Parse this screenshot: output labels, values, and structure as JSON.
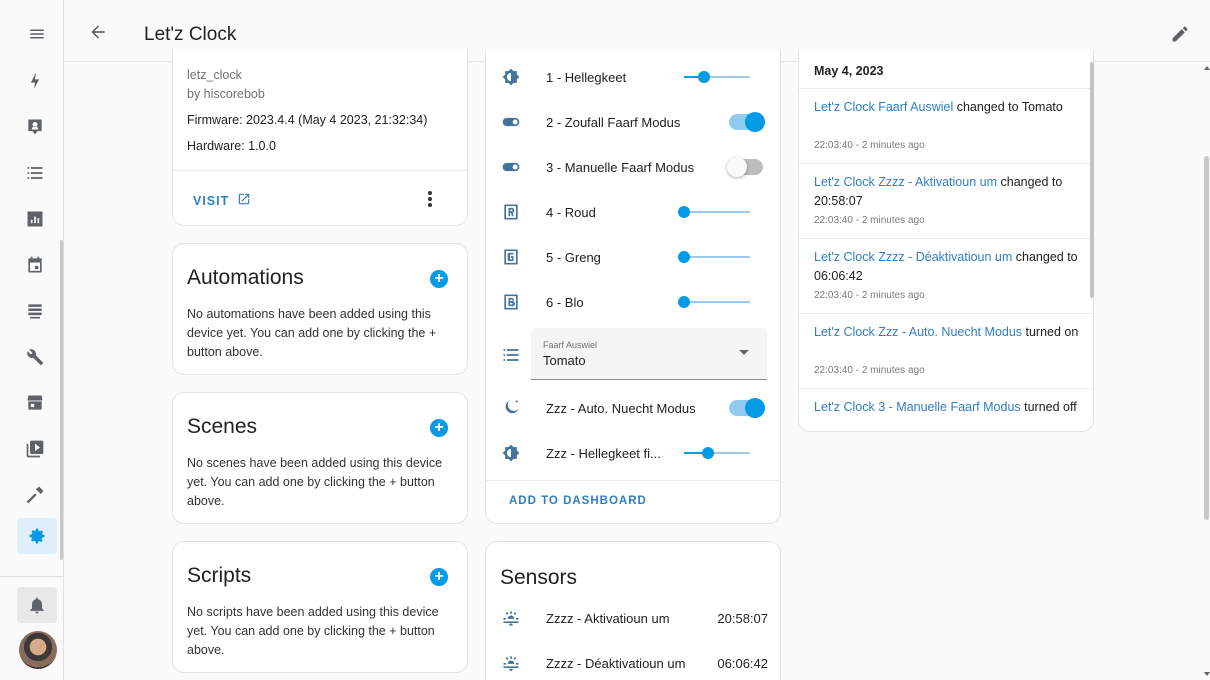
{
  "header": {
    "title": "Let'z Clock"
  },
  "device": {
    "name": "letz_clock",
    "by": "by hiscorebob",
    "firmware": "Firmware: 2023.4.4 (May 4 2023, 21:32:34)",
    "hardware": "Hardware: 1.0.0",
    "visit_label": "VISIT"
  },
  "automations": {
    "title": "Automations",
    "text": "No automations have been added using this device yet. You can add one by clicking the + button above."
  },
  "scenes": {
    "title": "Scenes",
    "text": "No scenes have been added using this device yet. You can add one by clicking the + button above."
  },
  "scripts": {
    "title": "Scripts",
    "text": "No scripts have been added using this device yet. You can add one by clicking the + button above."
  },
  "controls": {
    "rows": [
      {
        "label": "1 - Hellegkeet",
        "type": "slider",
        "value_fraction": 0.3,
        "icon": "brightness-icon"
      },
      {
        "label": "2 - Zoufall Faarf Modus",
        "type": "toggle",
        "on": true,
        "icon": "toggle-icon"
      },
      {
        "label": "3 - Manuelle Faarf Modus",
        "type": "toggle",
        "on": false,
        "icon": "toggle-icon"
      },
      {
        "label": "4 - Roud",
        "type": "slider",
        "value_fraction": 0.0,
        "icon": "letter-r-icon"
      },
      {
        "label": "5 - Greng",
        "type": "slider",
        "value_fraction": 0.0,
        "icon": "letter-g-icon"
      },
      {
        "label": "6 - Blo",
        "type": "slider",
        "value_fraction": 0.0,
        "icon": "letter-b-icon"
      }
    ],
    "select": {
      "label": "Faarf Auswiel",
      "value": "Tomato",
      "icon": "list-icon"
    },
    "night_mode": {
      "label": "Zzz - Auto. Nuecht Modus",
      "on": true,
      "icon": "night-icon"
    },
    "night_brightness": {
      "label": "Zzz - Hellegkeet fi...",
      "value_fraction": 0.37,
      "icon": "brightness-icon"
    },
    "add_to_dashboard": "ADD TO DASHBOARD"
  },
  "sensors": {
    "title": "Sensors",
    "rows": [
      {
        "label": "Zzzz - Aktivatioun um",
        "value": "20:58:07",
        "icon": "sunrise-icon"
      },
      {
        "label": "Zzzz - Déaktivatioun um",
        "value": "06:06:42",
        "icon": "sunset-icon"
      }
    ]
  },
  "logbook": {
    "date": "May 4, 2023",
    "entries": [
      {
        "entity": "Let'z Clock Faarf Auswiel",
        "action": " changed to Tomato",
        "time": "22:03:40 - 2 minutes ago"
      },
      {
        "entity": "Let'z Clock Zzzz - Aktivatioun um",
        "action": " changed to 20:58:07",
        "time": "22:03:40 - 2 minutes ago"
      },
      {
        "entity": "Let'z Clock Zzzz - Déaktivatioun um",
        "action": " changed to 06:06:42",
        "time": "22:03:40 - 2 minutes ago"
      },
      {
        "entity": "Let'z Clock Zzz - Auto. Nuecht Modus",
        "action": " turned on",
        "time": "22:03:40 - 2 minutes ago"
      },
      {
        "entity": "Let'z Clock 3 - Manuelle Faarf Modus",
        "action": " turned off",
        "time": ""
      }
    ]
  },
  "colors": {
    "accent": "#039be5",
    "link": "#2f7ec5",
    "icon": "#44739e"
  }
}
